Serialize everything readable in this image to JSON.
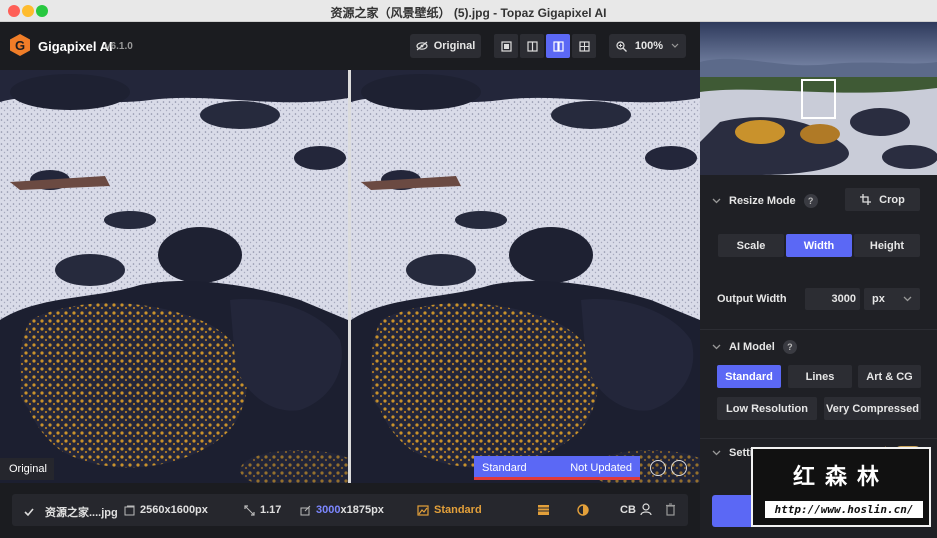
{
  "window": {
    "title": "资源之家（风景壁纸） (5).jpg - Topaz Gigapixel AI"
  },
  "app": {
    "name": "Gigapixel AI",
    "version": "v6.1.0",
    "accent": "#5b68f5",
    "brand": "#f07d28"
  },
  "toolbar": {
    "original_label": "Original",
    "zoom": "100%"
  },
  "preview": {
    "original_label": "Original",
    "status_model": "Standard",
    "status_state": "Not Updated"
  },
  "file_row": {
    "name": "资源之家....jpg",
    "input_size": "2560x1600px",
    "scale": "1.17",
    "output_w": "3000",
    "output_h": "x1875px",
    "model": "Standard",
    "cb": "CB"
  },
  "side": {
    "resize_mode": "Resize Mode",
    "crop": "Crop",
    "modes": [
      "Scale",
      "Width",
      "Height"
    ],
    "output_width_label": "Output Width",
    "output_width_value": "3000",
    "unit": "px",
    "ai_model": "AI Model",
    "models": [
      "Standard",
      "Lines",
      "Art & CG",
      "Low Resolution",
      "Very Compressed"
    ],
    "settings": "Settings"
  },
  "watermark": {
    "cn": "红森林",
    "url": "http://www.hoslin.cn/"
  }
}
